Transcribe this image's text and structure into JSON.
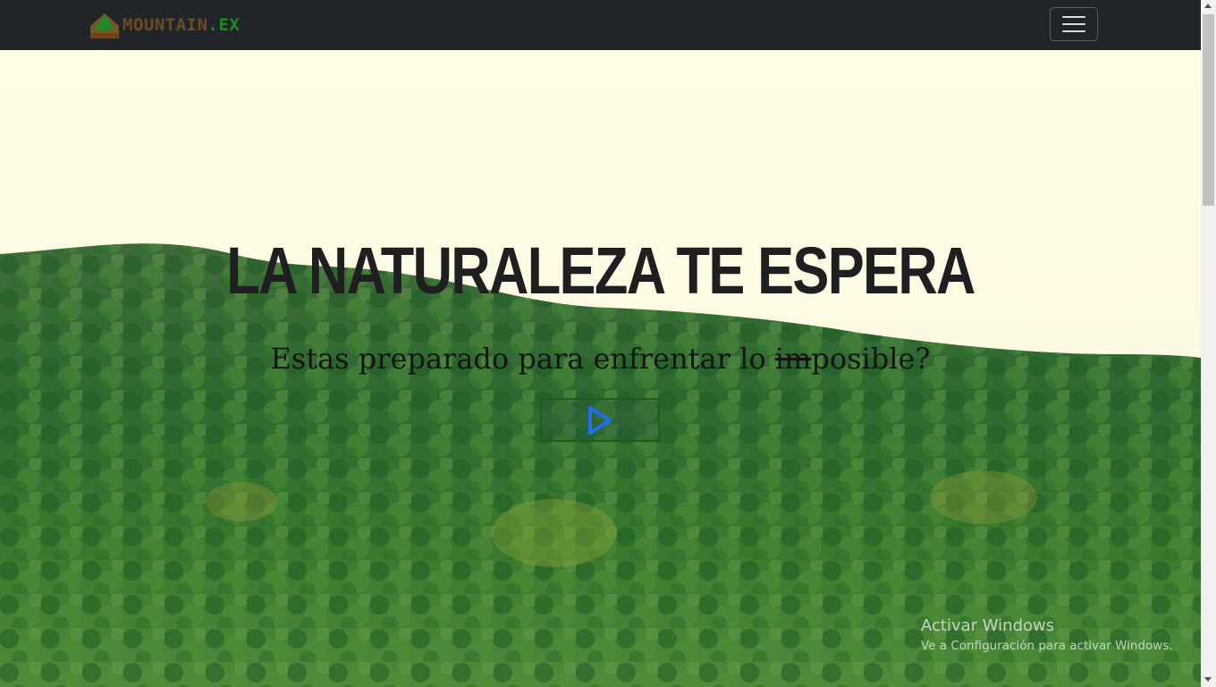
{
  "navbar": {
    "brand_main": "MOUNTAIN",
    "brand_ext": ".EX",
    "logo_icon": "mountain-logo-icon",
    "menu_icon": "hamburger-menu-icon"
  },
  "hero": {
    "title": "LA NATURALEZA TE ESPERA",
    "subtitle_before": "Estas preparado para enfrentar lo ",
    "subtitle_struck": "im",
    "subtitle_after": "posible?",
    "play_icon": "play-icon",
    "background": "forest-hillside-image"
  },
  "watermark": {
    "title": "Activar Windows",
    "subtitle": "Ve a Configuración para activar Windows."
  },
  "colors": {
    "navbar_bg": "#212529",
    "brand_brown": "#6b4a24",
    "brand_green": "#1b8a1b",
    "play_blue": "#1e6ff0",
    "play_border": "#1f5d1b"
  }
}
